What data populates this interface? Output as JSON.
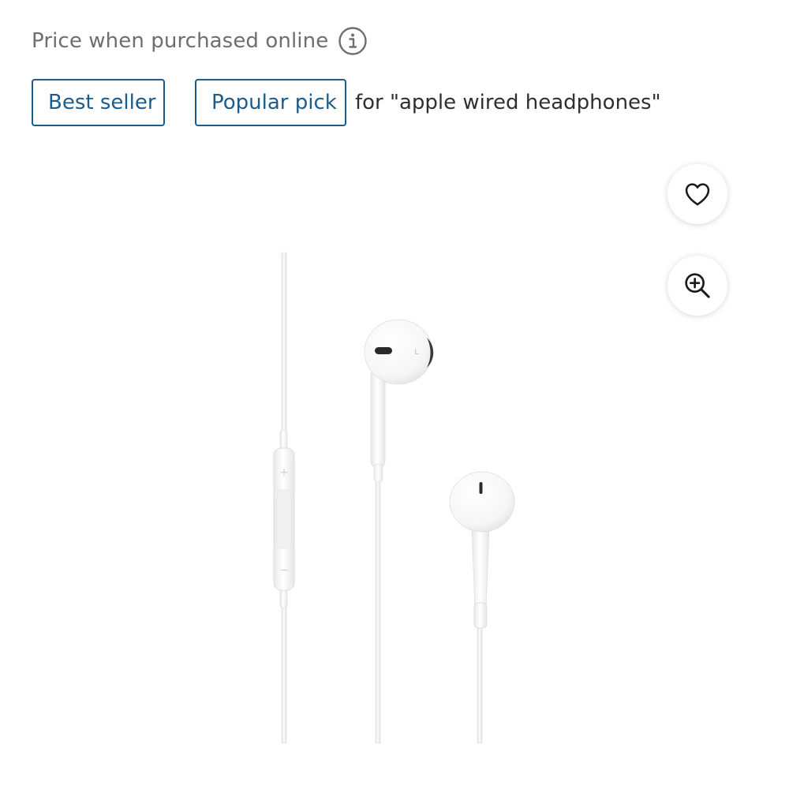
{
  "price_note": {
    "text": "Price when purchased online",
    "icon": "info-icon"
  },
  "badges": {
    "best_seller": "Best seller",
    "popular_pick": "Popular pick",
    "context": "for \"apple wired headphones\""
  },
  "actions": {
    "favorite_icon": "heart-icon",
    "zoom_icon": "zoom-in-icon"
  },
  "product_image": {
    "earbud_left_mark": "L",
    "remote_plus": "+",
    "remote_minus": "−"
  },
  "colors": {
    "badge_blue": "#1a5c8c",
    "muted_text": "#6d6e71",
    "body_text": "#2e2f32"
  }
}
